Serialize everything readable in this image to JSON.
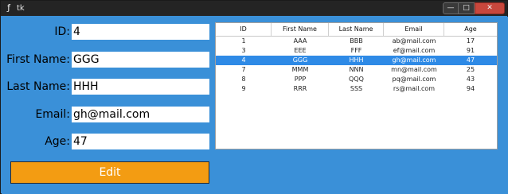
{
  "window": {
    "title": "tk",
    "buttons": {
      "minimize": "—",
      "maximize": "□",
      "close": "✕"
    }
  },
  "form": {
    "fields": [
      {
        "label": "ID:",
        "value": "4"
      },
      {
        "label": "First Name:",
        "value": "GGG"
      },
      {
        "label": "Last Name:",
        "value": "HHH"
      },
      {
        "label": "Email:",
        "value": "gh@mail.com"
      },
      {
        "label": "Age:",
        "value": "47"
      }
    ],
    "edit_label": "Edit"
  },
  "table": {
    "columns": [
      "ID",
      "First Name",
      "Last Name",
      "Email",
      "Age"
    ],
    "rows": [
      [
        "1",
        "AAA",
        "BBB",
        "ab@mail.com",
        "17"
      ],
      [
        "3",
        "EEE",
        "FFF",
        "ef@mail.com",
        "91"
      ],
      [
        "4",
        "GGG",
        "HHH",
        "gh@mail.com",
        "47"
      ],
      [
        "7",
        "MMM",
        "NNN",
        "mn@mail.com",
        "25"
      ],
      [
        "8",
        "PPP",
        "QQQ",
        "pq@mail.com",
        "43"
      ],
      [
        "9",
        "RRR",
        "SSS",
        "rs@mail.com",
        "94"
      ]
    ],
    "selected_row": 2
  },
  "colors": {
    "background": "#3a90d8",
    "button": "#f39c12",
    "selection": "#2e8ae6"
  }
}
